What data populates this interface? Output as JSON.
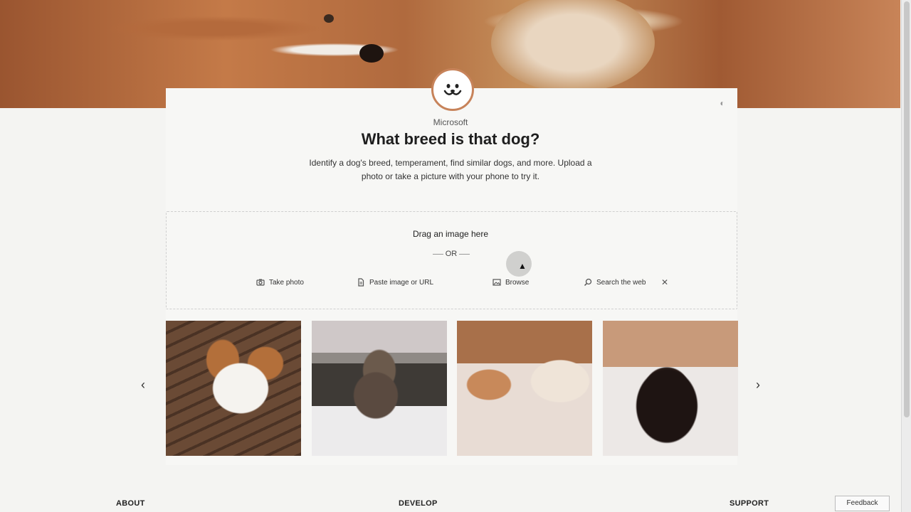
{
  "app": {
    "brand": "Microsoft",
    "title": "What breed is that dog?",
    "subtitle": "Identify a dog's breed, temperament, find similar dogs, and more. Upload a photo or take a picture with your phone to try it."
  },
  "upload": {
    "drag_text": "Drag an image here",
    "or_text": "OR",
    "actions": [
      {
        "label": "Take photo",
        "icon": "camera-icon"
      },
      {
        "label": "Paste image or URL",
        "icon": "document-icon"
      },
      {
        "label": "Browse",
        "icon": "image-icon"
      },
      {
        "label": "Search the web",
        "icon": "search-icon"
      }
    ]
  },
  "carousel": {
    "images": [
      {
        "name": "puppy-spaniel"
      },
      {
        "name": "husky-snow"
      },
      {
        "name": "corgi-and-terrier"
      },
      {
        "name": "bernese-snow"
      }
    ]
  },
  "footer": {
    "about": "ABOUT",
    "develop": "DEVELOP",
    "support": "SUPPORT",
    "feedback": "Feedback"
  },
  "colors": {
    "accent": "#c7835a",
    "background": "#f4f4f2"
  }
}
